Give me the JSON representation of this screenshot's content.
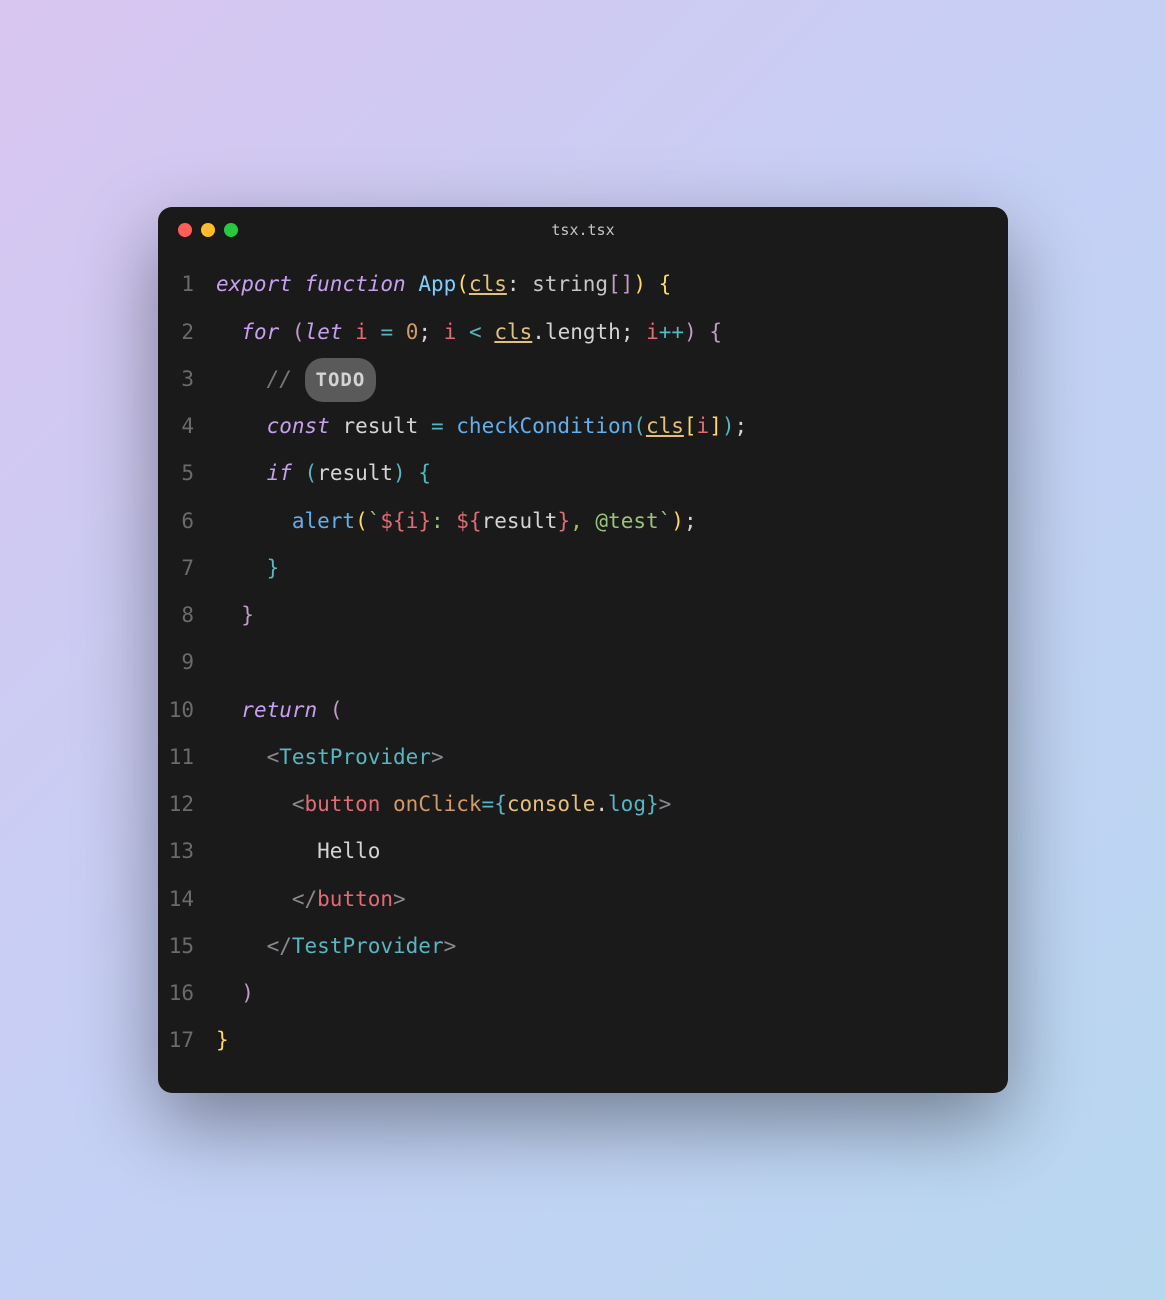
{
  "window": {
    "title": "tsx.tsx"
  },
  "code": {
    "line_count": 17,
    "tokens": {
      "l1": {
        "export": "export",
        "function": "function",
        "fnName": "App",
        "param": "cls",
        "type": "string"
      },
      "l2": {
        "for": "for",
        "let": "let",
        "var": "i",
        "zero": "0",
        "cls": "cls",
        "length": "length"
      },
      "l3": {
        "comment": "//",
        "todo": "TODO"
      },
      "l4": {
        "const": "const",
        "result": "result",
        "checkCondition": "checkCondition",
        "cls": "cls",
        "i": "i"
      },
      "l5": {
        "if": "if",
        "result": "result"
      },
      "l6": {
        "alert": "alert",
        "i": "i",
        "result": "result",
        "test": "@test",
        "sep": ": ",
        "comma": ", "
      },
      "l10": {
        "return": "return"
      },
      "l11": {
        "tag": "TestProvider"
      },
      "l12": {
        "tag": "button",
        "attr": "onClick",
        "console": "console",
        "log": "log"
      },
      "l13": {
        "text": "Hello"
      },
      "l14": {
        "tag": "button"
      },
      "l15": {
        "tag": "TestProvider"
      }
    }
  },
  "colors": {
    "bg": "#1a1a1a",
    "keyword": "#c8a0f0",
    "function": "#7dcfff",
    "param": "#e5c07b",
    "number": "#d19a66",
    "string": "#98c379",
    "tag": "#e06c75"
  }
}
